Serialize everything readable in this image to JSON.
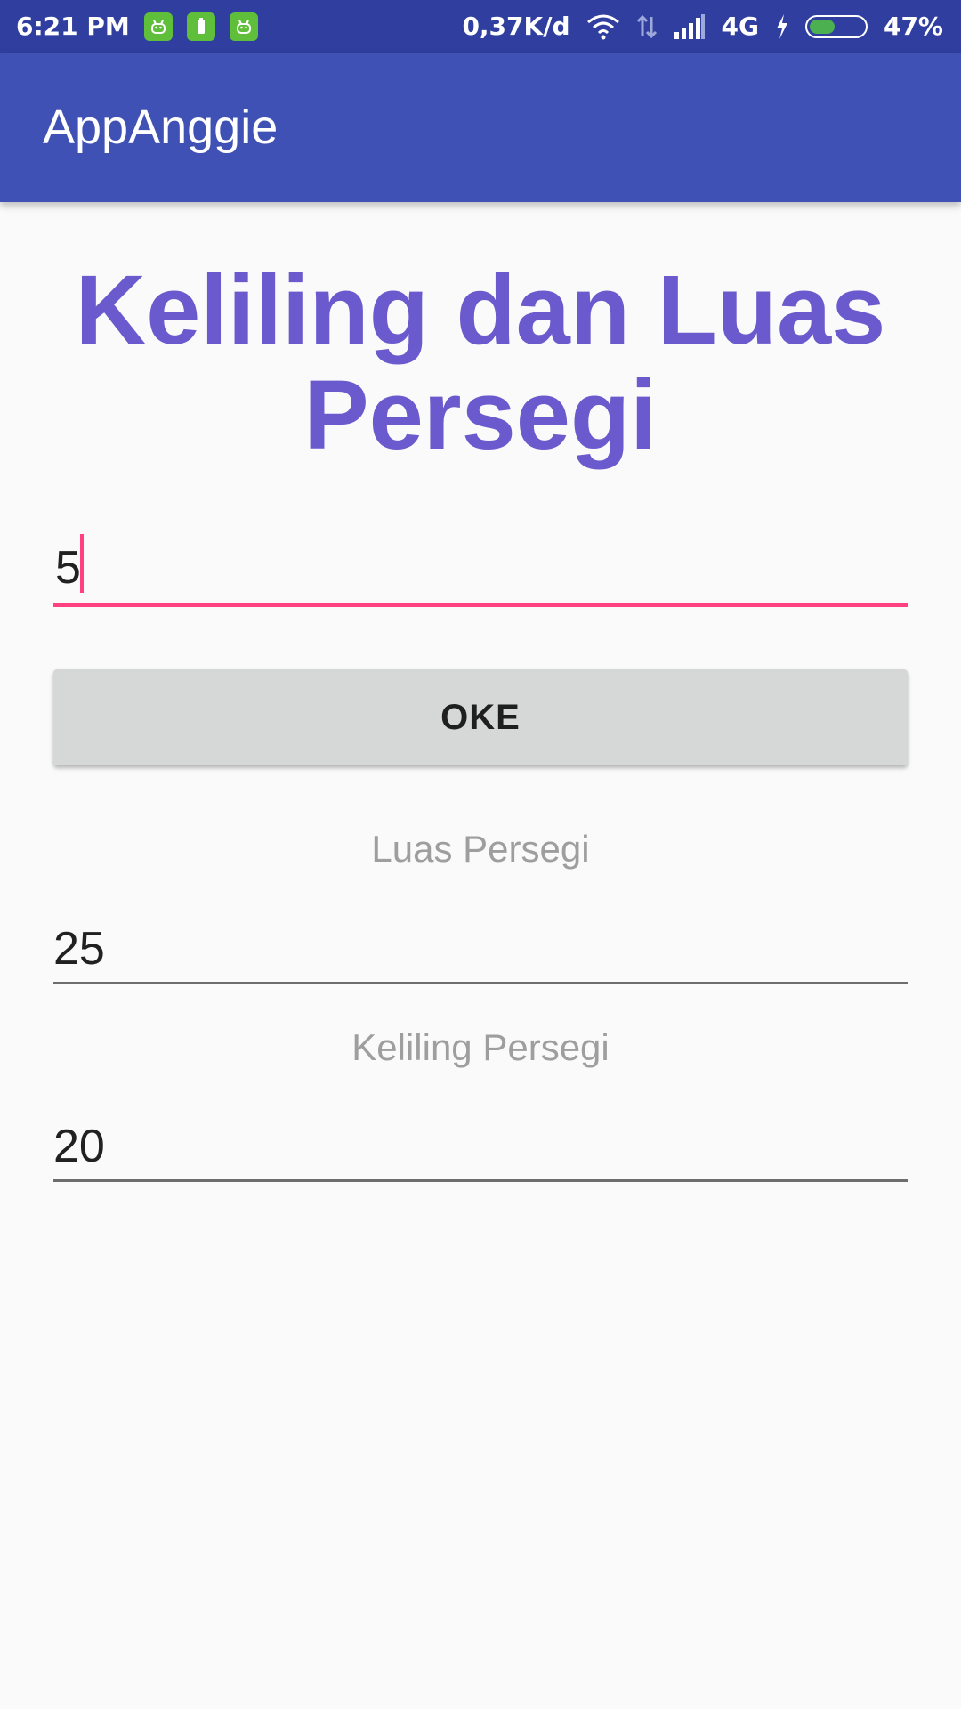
{
  "status_bar": {
    "time": "6:21 PM",
    "speed": "0,37K/d",
    "network": "4G",
    "battery": "47%",
    "battery_level": 0.47,
    "icons": [
      "android-notification-icon",
      "battery-notification-icon",
      "android-notification-icon",
      "wifi-icon",
      "data-transfer-icon",
      "signal-icon",
      "charging-icon",
      "battery-icon"
    ]
  },
  "app_bar": {
    "title": "AppAnggie"
  },
  "main": {
    "heading": "Keliling dan Luas Persegi",
    "side_input": {
      "value": "5"
    },
    "ok_button": {
      "label": "OKE"
    },
    "luas": {
      "label": "Luas Persegi",
      "value": "25"
    },
    "keliling": {
      "label": "Keliling Persegi",
      "value": "20"
    }
  },
  "colors": {
    "status_bar": "#303f9f",
    "app_bar": "#3f51b5",
    "heading": "#6a5acd",
    "accent": "#ff4081",
    "button": "#d6d7d7"
  }
}
